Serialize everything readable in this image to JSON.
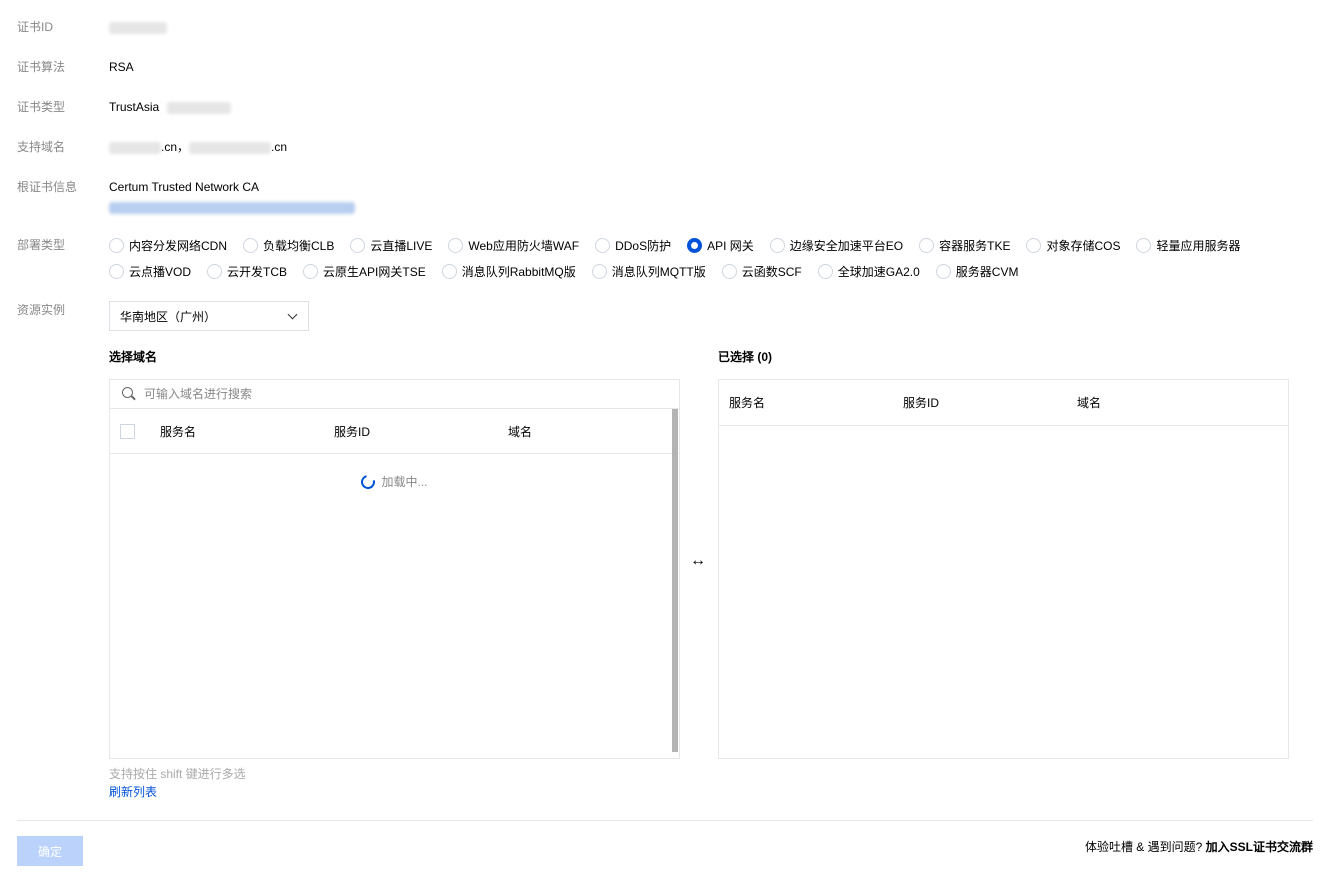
{
  "form": {
    "cert_id_label": "证书ID",
    "algo_label": "证书算法",
    "algo_value": "RSA",
    "type_label": "证书类型",
    "type_value": "TrustAsia",
    "domains_label": "支持域名",
    "domain_suffix_1": ".cn，",
    "domain_suffix_2": ".cn",
    "root_label": "根证书信息",
    "root_value": "Certum Trusted Network CA",
    "deploy_label": "部署类型",
    "resource_label": "资源实例",
    "region_value": "华南地区（广州）"
  },
  "deploy_types": {
    "row1": [
      {
        "label": "内容分发网络CDN",
        "checked": false
      },
      {
        "label": "负载均衡CLB",
        "checked": false
      },
      {
        "label": "云直播LIVE",
        "checked": false
      },
      {
        "label": "Web应用防火墙WAF",
        "checked": false
      },
      {
        "label": "DDoS防护",
        "checked": false
      },
      {
        "label": "API 网关",
        "checked": true
      },
      {
        "label": "边缘安全加速平台EO",
        "checked": false
      },
      {
        "label": "容器服务TKE",
        "checked": false
      },
      {
        "label": "对象存储COS",
        "checked": false
      },
      {
        "label": "轻量应用服务器",
        "checked": false
      }
    ],
    "row2": [
      {
        "label": "云点播VOD",
        "checked": false
      },
      {
        "label": "云开发TCB",
        "checked": false
      },
      {
        "label": "云原生API网关TSE",
        "checked": false
      },
      {
        "label": "消息队列RabbitMQ版",
        "checked": false
      },
      {
        "label": "消息队列MQTT版",
        "checked": false
      },
      {
        "label": "云函数SCF",
        "checked": false
      },
      {
        "label": "全球加速GA2.0",
        "checked": false
      },
      {
        "label": "服务器CVM",
        "checked": false
      }
    ]
  },
  "left_panel": {
    "title": "选择域名",
    "search_placeholder": "可输入域名进行搜索",
    "col_service": "服务名",
    "col_id": "服务ID",
    "col_domain": "域名",
    "loading": "加载中..."
  },
  "right_panel": {
    "title": "已选择 (0)",
    "col_service": "服务名",
    "col_id": "服务ID",
    "col_domain": "域名"
  },
  "transfer_icon": "↔",
  "hint": "支持按住 shift 键进行多选",
  "refresh_link": "刷新列表",
  "confirm_button": "确定",
  "feedback_text": "体验吐槽 & 遇到问题?",
  "feedback_link": "加入SSL证书交流群"
}
